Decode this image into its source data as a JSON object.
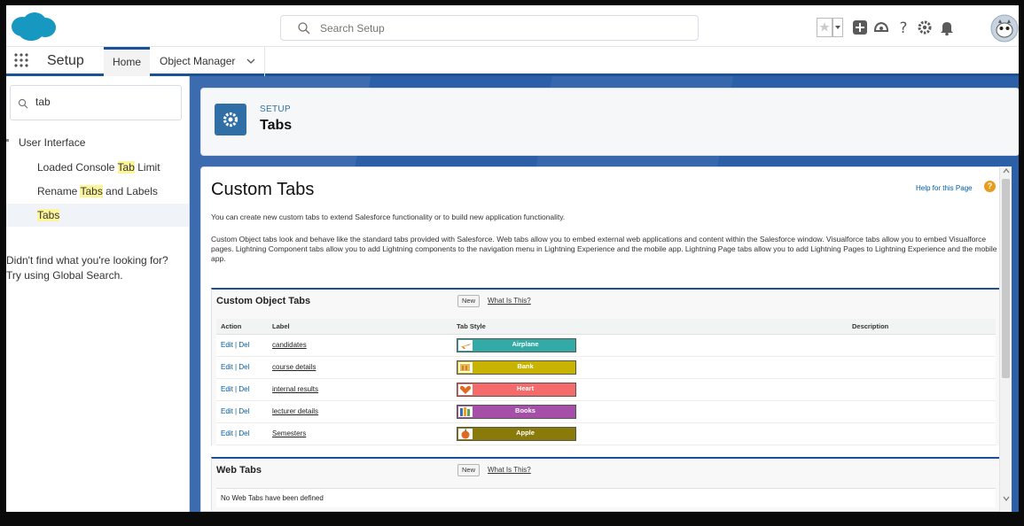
{
  "header": {
    "search_placeholder": "Search Setup"
  },
  "nav": {
    "app_name": "Setup",
    "tabs": [
      {
        "label": "Home"
      },
      {
        "label": "Object Manager"
      }
    ]
  },
  "sidebar": {
    "quick_find_value": "tab",
    "parent": "User Interface",
    "children": [
      {
        "pre": "Loaded Console ",
        "hl": "Tab",
        "post": " Limit"
      },
      {
        "pre": "Rename ",
        "hl": "Tabs",
        "post": " and Labels"
      },
      {
        "pre": "",
        "hl": "Tabs",
        "post": ""
      }
    ],
    "not_found_line1": "Didn't find what you're looking for?",
    "not_found_line2": "Try using Global Search."
  },
  "setup_header": {
    "kicker": "SETUP",
    "title": "Tabs"
  },
  "content": {
    "title": "Custom Tabs",
    "help_link": "Help for this Page",
    "help_icon": "?",
    "intro": "You can create new custom tabs to extend Salesforce functionality or to build new application functionality.",
    "description": "Custom Object tabs look and behave like the standard tabs provided with Salesforce. Web tabs allow you to embed external web applications and content within the Salesforce window. Visualforce tabs allow you to embed Visualforce pages. Lightning Component tabs allow you to add Lightning components to the navigation menu in Lightning Experience and the mobile app. Lightning Page tabs allow you to add Lightning Pages to Lightning Experience and the mobile app."
  },
  "custom_object_tabs": {
    "title": "Custom Object Tabs",
    "new_label": "New",
    "what_is_this": "What Is This?",
    "columns": [
      "Action",
      "Label",
      "Tab Style",
      "Description"
    ],
    "action_edit": "Edit",
    "action_sep": " | ",
    "action_del": "Del",
    "rows": [
      {
        "label": "candidates",
        "style": "Airplane",
        "color": "#33aaa5",
        "icon": "airplane-icon"
      },
      {
        "label": "course details",
        "style": "Bank",
        "color": "#c8b400",
        "icon": "bank-icon"
      },
      {
        "label": "internal results",
        "style": "Heart",
        "color": "#f56b6b",
        "icon": "heart-icon"
      },
      {
        "label": "lecturer details",
        "style": "Books",
        "color": "#a54fa8",
        "icon": "books-icon"
      },
      {
        "label": "Semesters",
        "style": "Apple",
        "color": "#8a7a0a",
        "icon": "apple-icon"
      }
    ]
  },
  "web_tabs": {
    "title": "Web Tabs",
    "new_label": "New",
    "what_is_this": "What Is This?",
    "empty_text": "No Web Tabs have been defined"
  },
  "colors": {
    "brand_blue": "#1b5297",
    "link": "#015ba7",
    "highlight": "#fdf59a"
  }
}
